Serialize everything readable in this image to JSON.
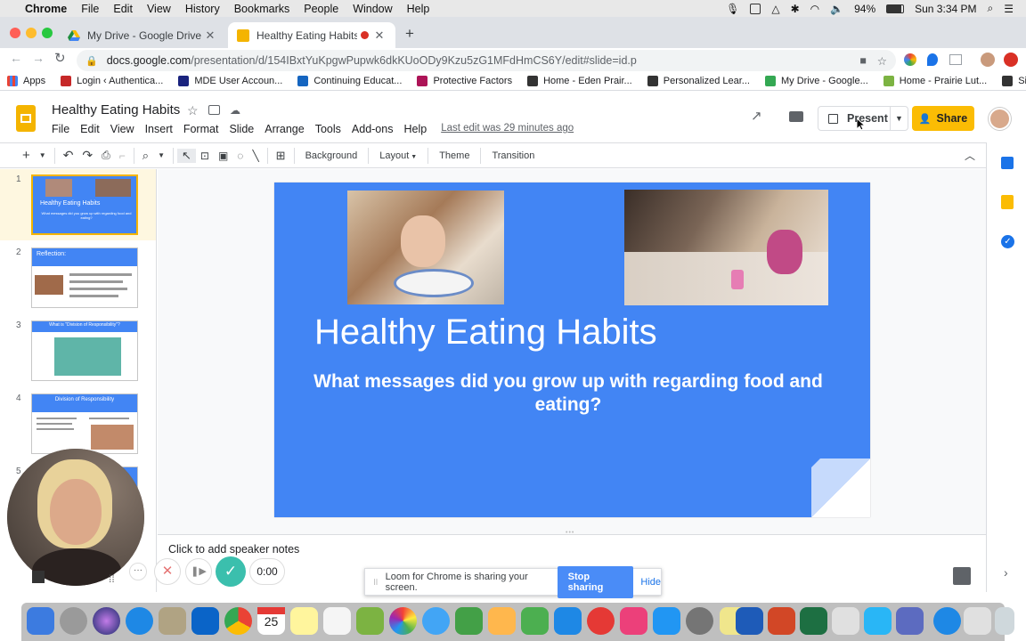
{
  "mac_menu": {
    "app": "Chrome",
    "items": [
      "File",
      "Edit",
      "View",
      "History",
      "Bookmarks",
      "People",
      "Window",
      "Help"
    ],
    "battery": "94%",
    "clock": "Sun 3:34 PM"
  },
  "tabs": [
    {
      "title": "My Drive - Google Drive",
      "active": false
    },
    {
      "title": "Healthy Eating Habits - Go",
      "active": true
    }
  ],
  "address": {
    "host": "docs.google.com",
    "path": "/presentation/d/154IBxtYuKpgwPupwk6dkKUoODy9Kzu5zG1MFdHmCS6Y/edit#slide=id.p"
  },
  "bookmarks": [
    {
      "label": "Apps",
      "color": "#4285f4"
    },
    {
      "label": "Login ‹ Authentica...",
      "color": "#c62828"
    },
    {
      "label": "MDE User Accoun...",
      "color": "#1a237e"
    },
    {
      "label": "Continuing Educat...",
      "color": "#1565c0"
    },
    {
      "label": "Protective Factors",
      "color": "#ad1457"
    },
    {
      "label": "Home - Eden Prair...",
      "color": "#333333"
    },
    {
      "label": "Personalized Lear...",
      "color": "#333333"
    },
    {
      "label": "My Drive - Google...",
      "color": "#34a853"
    },
    {
      "label": "Home - Prairie Lut...",
      "color": "#7cb342"
    },
    {
      "label": "Sign in",
      "color": "#333333"
    }
  ],
  "doc": {
    "title": "Healthy Eating Habits",
    "menu": [
      "File",
      "Edit",
      "View",
      "Insert",
      "Format",
      "Slide",
      "Arrange",
      "Tools",
      "Add-ons",
      "Help"
    ],
    "last_edit": "Last edit was 29 minutes ago",
    "present_label": "Present",
    "share_label": "Share"
  },
  "toolbar": {
    "background_label": "Background",
    "layout_label": "Layout",
    "theme_label": "Theme",
    "transition_label": "Transition"
  },
  "filmstrip": [
    {
      "num": "1",
      "title": "Healthy Eating Habits",
      "sub": "What messages did you grow up with regarding food and eating?"
    },
    {
      "num": "2",
      "title": "Reflection:",
      "sub": ""
    },
    {
      "num": "3",
      "title": "What is \"Division of Responsibility\"?",
      "sub": ""
    },
    {
      "num": "4",
      "title": "Division of Responsibility",
      "sub": ""
    },
    {
      "num": "5",
      "title": "",
      "sub": ""
    }
  ],
  "slide": {
    "title": "Healthy Eating Habits",
    "subtitle": "What messages did you grow up with regarding food and eating?"
  },
  "notes": {
    "placeholder": "Click to add speaker notes"
  },
  "loom": {
    "timer": "0:00",
    "message": "Loom for Chrome is sharing your screen.",
    "stop_label": "Stop sharing",
    "hide_label": "Hide"
  },
  "dock": {
    "calendar_day": "25"
  },
  "colors": {
    "slide_blue": "#4285f4",
    "share_yellow": "#fbbc04",
    "loom_blue": "#4a8cf7",
    "loom_teal": "#3bbfad"
  }
}
